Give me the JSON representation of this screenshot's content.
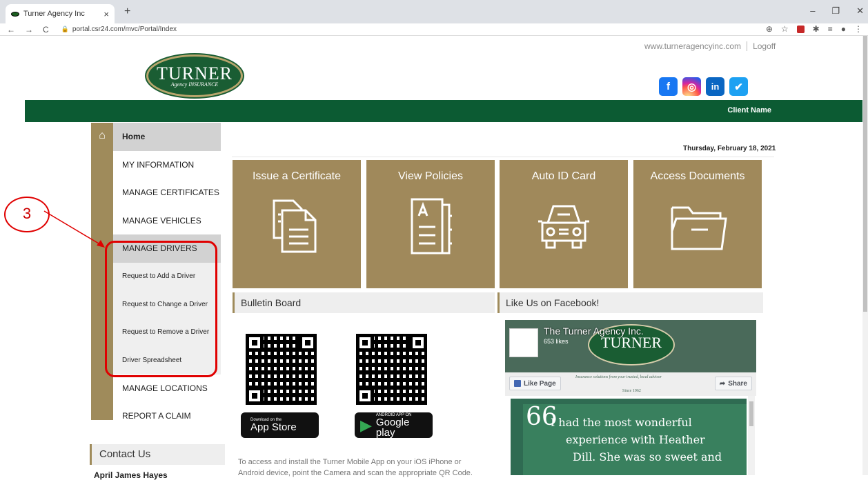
{
  "browser": {
    "tab_title": "Turner Agency Inc",
    "tab_close": "×",
    "new_tab": "+",
    "url": "portal.csr24.com/mvc/Portal/Index",
    "nav": {
      "back": "←",
      "forward": "→",
      "reload": "C"
    },
    "window_controls": {
      "minimize": "–",
      "restore": "❐",
      "close": "✕"
    },
    "tools": {
      "zoom": "⊕",
      "star": "☆",
      "ext": "✱",
      "queue": "≡",
      "profile": "●",
      "menu": "⋮"
    }
  },
  "header": {
    "logo_big": "TURNER",
    "logo_small": "Agency INSURANCE",
    "website_link": "www.turneragencyinc.com",
    "logoff_link": "Logoff",
    "social": {
      "facebook": "f",
      "instagram": "◎",
      "linkedin": "in",
      "twitter": "✔"
    },
    "client_name": "Client Name"
  },
  "sidebar": {
    "home_icon": "⌂",
    "items": [
      {
        "label": "Home"
      },
      {
        "label": "MY INFORMATION"
      },
      {
        "label": "MANAGE CERTIFICATES"
      },
      {
        "label": "MANAGE VEHICLES"
      },
      {
        "label": "MANAGE DRIVERS"
      },
      {
        "label": "Request to Add a Driver"
      },
      {
        "label": "Request to Change a Driver"
      },
      {
        "label": "Request to Remove a Driver"
      },
      {
        "label": "Driver Spreadsheet"
      },
      {
        "label": "MANAGE LOCATIONS"
      },
      {
        "label": "REPORT A CLAIM"
      }
    ],
    "contact_title": "Contact Us",
    "contact_name": "April James Hayes"
  },
  "main": {
    "date": "Thursday, February 18, 2021",
    "tiles": [
      {
        "label": "Issue a Certificate"
      },
      {
        "label": "View Policies"
      },
      {
        "label": "Auto ID Card"
      },
      {
        "label": "Access Documents"
      }
    ],
    "bulletin_title": "Bulletin Board",
    "facebook_title": "Like Us on Facebook!",
    "app_store": {
      "tiny": "Download on the",
      "name": "App Store",
      "glyph": ""
    },
    "google_play": {
      "tiny": "ANDROID APP ON",
      "name": "Google play",
      "glyph": "▶"
    },
    "app_text": "To access and install the Turner Mobile App on your iOS iPhone or Android device, point the Camera and scan the appropriate QR Code."
  },
  "facebook_widget": {
    "page_name": "The Turner Agency Inc.",
    "likes": "653 likes",
    "cover_logo": "TURNER",
    "tagline": "Insurance solutions from your trusted, local advisor",
    "since": "Since 1962",
    "like_button": "Like Page",
    "share_button": "Share",
    "quote_mark": "66",
    "post_lines": [
      "I had the most wonderful",
      "experience with Heather",
      "Dill. She was so sweet and"
    ]
  },
  "annotation": {
    "number": "3"
  }
}
